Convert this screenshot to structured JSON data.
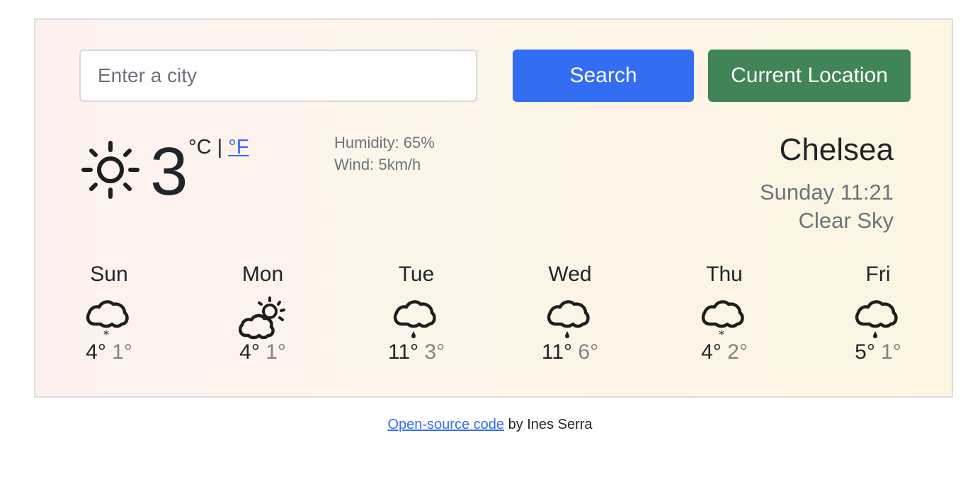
{
  "search": {
    "placeholder": "Enter a city",
    "value": "",
    "search_label": "Search",
    "location_label": "Current Location"
  },
  "colors": {
    "search_button": "#336df4",
    "location_button": "#418457",
    "link": "#336df4",
    "muted_text": "#6c737b",
    "min_temp": "#808285"
  },
  "current": {
    "icon": "sun-icon",
    "temperature": "3",
    "unit_celsius": "°C",
    "unit_separator": " | ",
    "unit_fahrenheit": "°F",
    "humidity": "Humidity: 65%",
    "wind": "Wind: 5km/h",
    "city": "Chelsea",
    "datetime": "Sunday 11:21",
    "description": "Clear Sky"
  },
  "forecast": [
    {
      "day": "Sun",
      "icon": "cloud-snow-icon",
      "max": "4°",
      "min": "1°"
    },
    {
      "day": "Mon",
      "icon": "partly-cloudy-icon",
      "max": "4°",
      "min": "1°"
    },
    {
      "day": "Tue",
      "icon": "cloud-rain-icon",
      "max": "11°",
      "min": "3°"
    },
    {
      "day": "Wed",
      "icon": "cloud-rain-icon",
      "max": "11°",
      "min": "6°"
    },
    {
      "day": "Thu",
      "icon": "cloud-snow-icon",
      "max": "4°",
      "min": "2°"
    },
    {
      "day": "Fri",
      "icon": "cloud-rain-icon",
      "max": "5°",
      "min": "1°"
    }
  ],
  "footer": {
    "link_text": "Open-source code",
    "suffix": " by Ines Serra"
  }
}
